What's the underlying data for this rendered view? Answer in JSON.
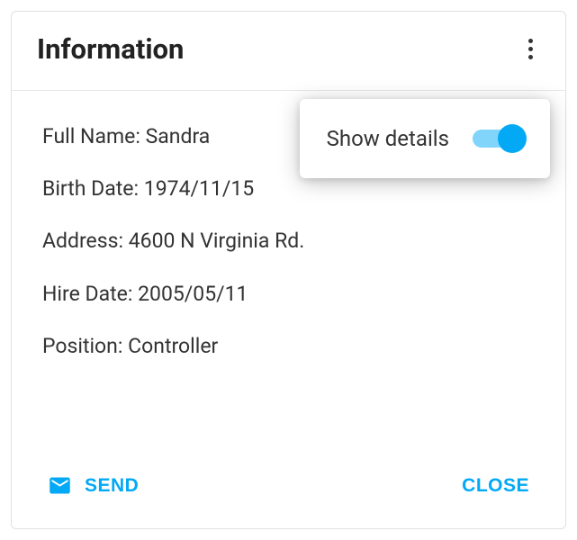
{
  "header": {
    "title": "Information"
  },
  "info": {
    "rows": [
      {
        "label": "Full Name",
        "value": "Sandra"
      },
      {
        "label": "Birth Date",
        "value": "1974/11/15"
      },
      {
        "label": "Address",
        "value": "4600 N Virginia Rd."
      },
      {
        "label": "Hire Date",
        "value": "2005/05/11"
      },
      {
        "label": "Position",
        "value": "Controller"
      }
    ]
  },
  "actions": {
    "send_label": "SEND",
    "close_label": "CLOSE"
  },
  "popover": {
    "label": "Show details",
    "switch_on": true
  }
}
